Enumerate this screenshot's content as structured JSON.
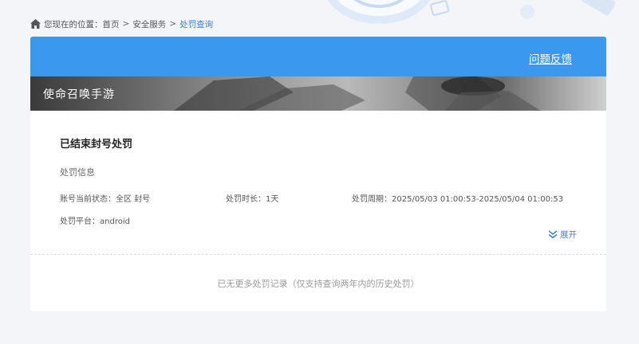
{
  "breadcrumb": {
    "prefix": "您现在的位置：",
    "items": [
      "首页",
      "安全服务",
      "处罚查询"
    ],
    "separator": ">"
  },
  "header": {
    "feedback_label": "问题反馈"
  },
  "banner": {
    "game_title": "使命召唤手游"
  },
  "record": {
    "status_title": "已结束封号处罚",
    "section_label": "处罚信息",
    "account_status": "账号当前状态：全区 封号",
    "duration": "处罚时长：1天",
    "period": "处罚周期：2025/05/03 01:00:53-2025/05/04 01:00:53",
    "platform": "处罚平台：android",
    "expand_label": "展开"
  },
  "footer": {
    "no_more_text": "已无更多处罚记录（仅支持查询两年内的历史处罚）"
  },
  "colors": {
    "accent": "#3a99ef",
    "link": "#3a7fd5",
    "page_bg": "#f3f5f8"
  },
  "icons": {
    "home": "home-icon",
    "expand": "double-chevron-down-icon"
  }
}
